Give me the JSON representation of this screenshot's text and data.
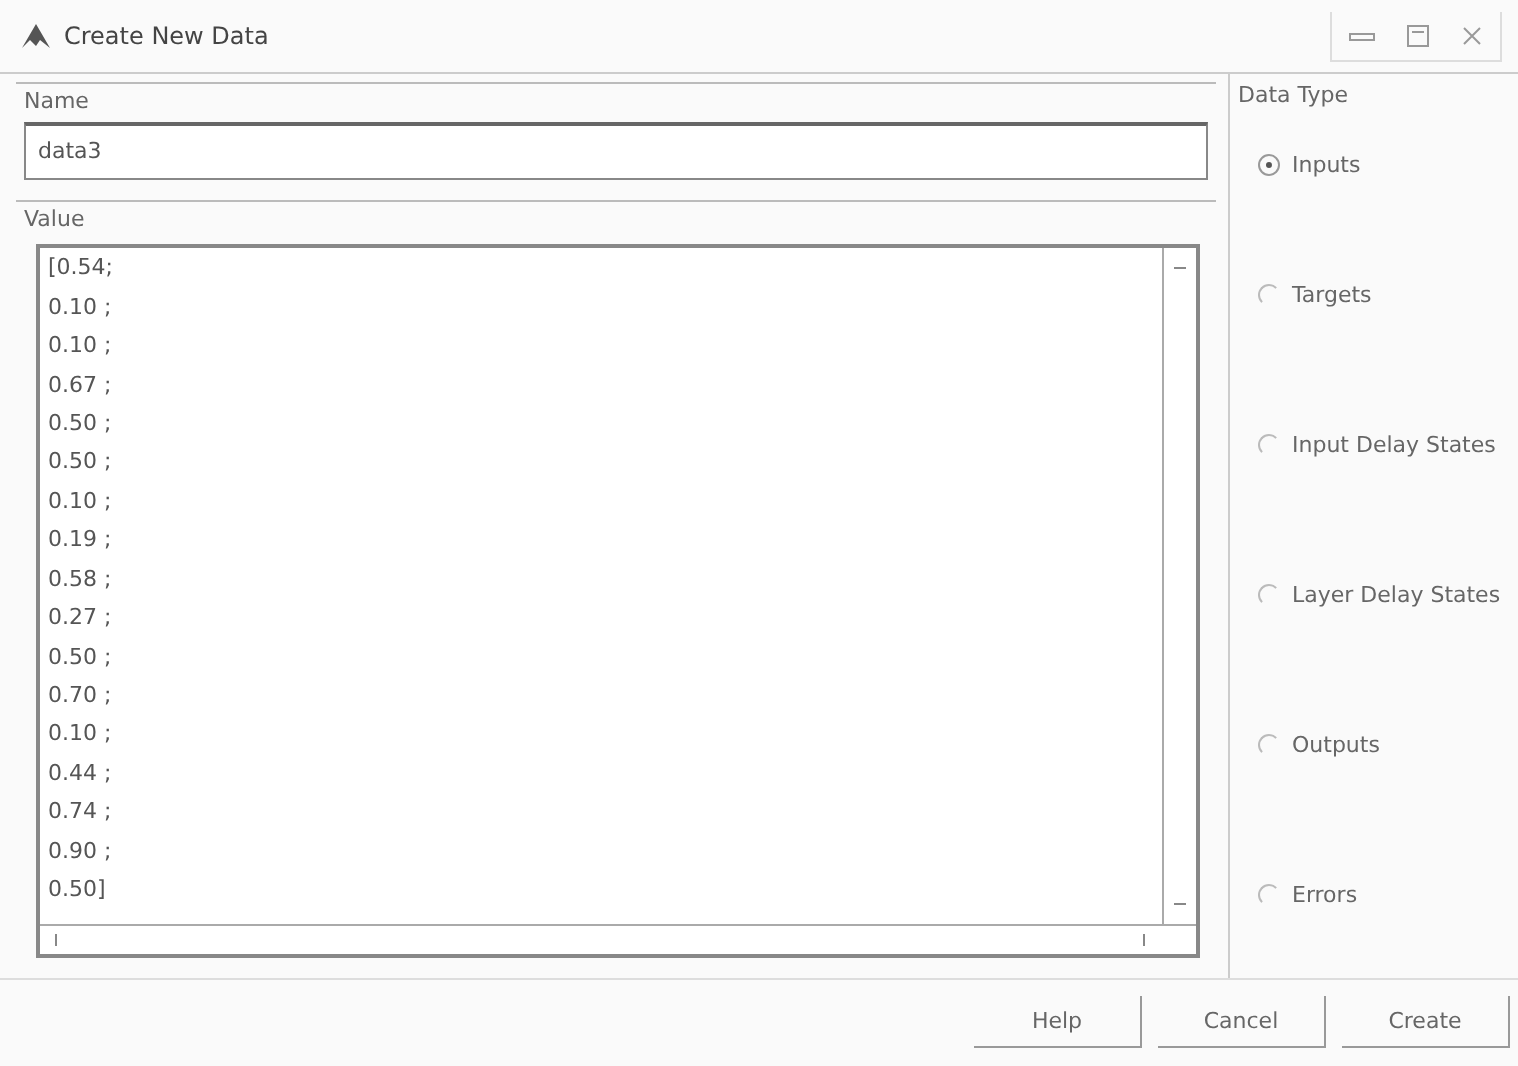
{
  "window": {
    "title": "Create New Data"
  },
  "name_group": {
    "label": "Name",
    "value": "data3"
  },
  "value_group": {
    "label": "Value",
    "lines": [
      "[0.54;",
      "0.10 ;",
      "0.10 ;",
      "0.67 ;",
      "0.50 ;",
      "0.50 ;",
      "0.10 ;",
      "0.19 ;",
      "0.58 ;",
      "0.27 ;",
      "0.50 ;",
      "0.70 ;",
      "0.10 ;",
      "0.44 ;",
      "0.74 ;",
      "0.90 ;",
      "0.50]"
    ]
  },
  "data_type": {
    "label": "Data Type",
    "options": [
      {
        "label": "Inputs",
        "selected": true
      },
      {
        "label": "Targets",
        "selected": false
      },
      {
        "label": "Input Delay States",
        "selected": false
      },
      {
        "label": "Layer Delay States",
        "selected": false
      },
      {
        "label": "Outputs",
        "selected": false
      },
      {
        "label": "Errors",
        "selected": false
      }
    ]
  },
  "buttons": [
    "Help",
    "Cancel",
    "Create"
  ]
}
